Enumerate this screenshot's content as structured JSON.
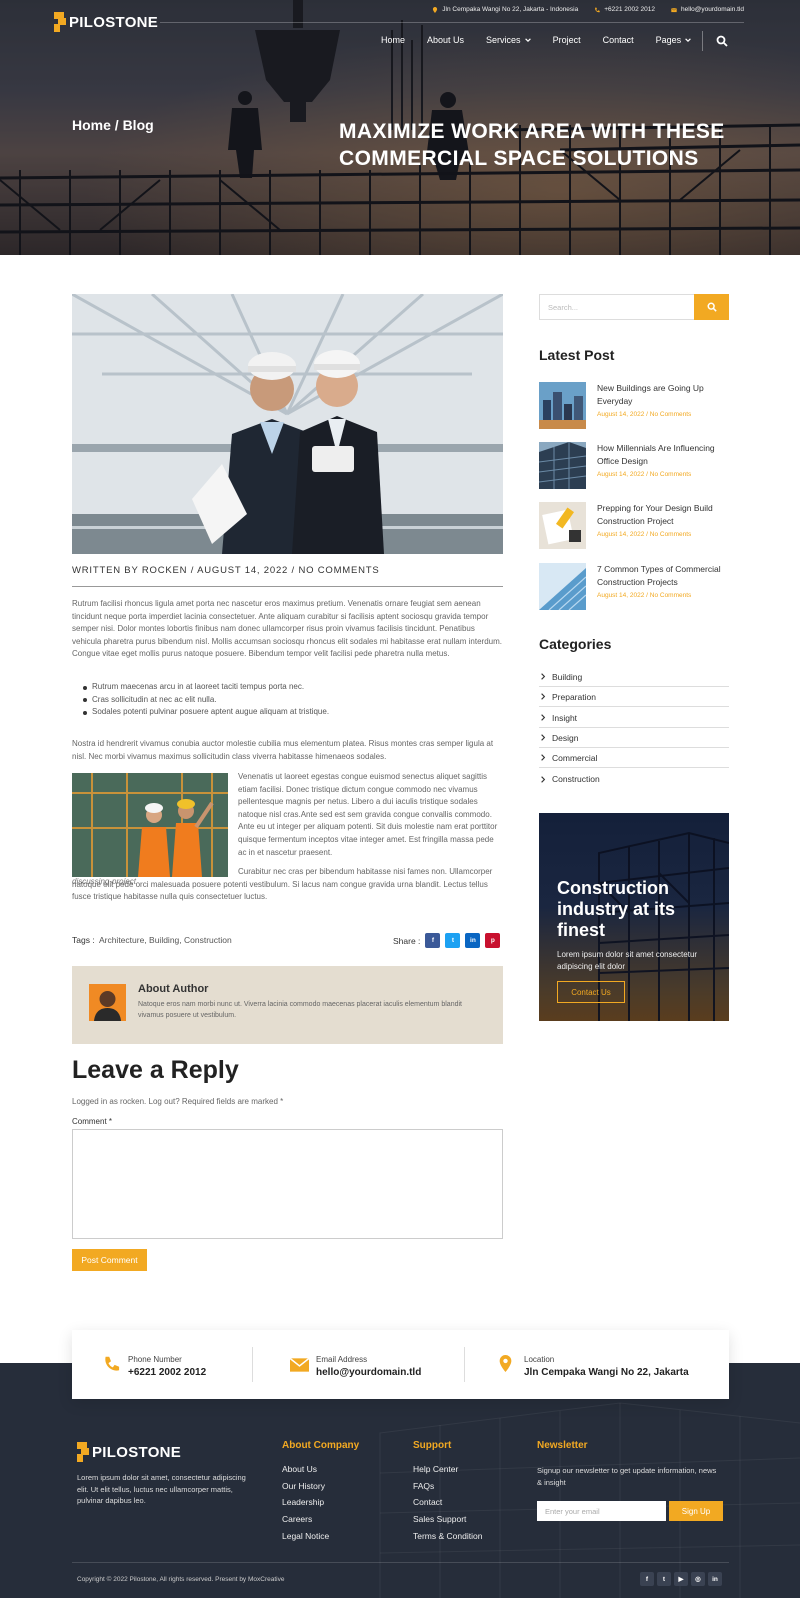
{
  "brand": {
    "name": "PILOSTONE"
  },
  "topbar": {
    "address": "Jln Cempaka Wangi No 22, Jakarta - Indonesia",
    "phone": "+6221 2002 2012",
    "email": "hello@yourdomain.tld"
  },
  "nav": {
    "items": [
      "Home",
      "About Us",
      "Services",
      "Project",
      "Contact",
      "Pages"
    ]
  },
  "hero": {
    "breadcrumb": "Home / Blog",
    "title": "MAXIMIZE WORK AREA WITH THESE COMMERCIAL SPACE SOLUTIONS"
  },
  "post": {
    "meta": "WRITTEN BY ROCKEN / AUGUST 14, 2022 / NO COMMENTS",
    "p1": "Rutrum facilisi rhoncus ligula amet porta nec nascetur eros maximus pretium. Venenatis ornare feugiat sem aenean tincidunt neque porta imperdiet lacinia consectetuer. Ante aliquam curabitur si facilisis aptent sociosqu gravida tempor semper nisi. Dolor montes lobortis finibus nam donec ullamcorper risus proin vivamus facilisis tincidunt. Penatibus vehicula pharetra purus bibendum nisl. Mollis accumsan sociosqu rhoncus elit sodales mi habitasse erat nullam interdum. Congue vitae eget mollis purus natoque posuere. Bibendum tempor velit facilisi pede pharetra nulla metus.",
    "bullets": [
      "Rutrum maecenas arcu in at laoreet taciti tempus porta nec.",
      "Cras sollicitudin at nec ac elit nulla.",
      "Sodales potenti pulvinar posuere aptent augue aliquam at tristique."
    ],
    "p2": "Nostra id hendrerit vivamus conubia auctor molestie cubilia mus elementum platea. Risus montes cras semper ligula at nisl. Nec morbi vivamus maximus sollicitudin class viverra habitasse himenaeos sodales.",
    "p3": "Venenatis ut laoreet egestas congue euismod senectus aliquet sagittis etiam facilisi. Donec tristique dictum congue commodo nec vivamus pellentesque magnis per netus. Libero a dui iaculis tristique sodales natoque nisl cras.Ante sed est sem gravida congue convallis commodo. Ante eu ut integer per aliquam potenti. Sit duis molestie nam erat porttitor quisque fermentum inceptos vitae integer amet. Est fringilla massa pede ac in et nascetur praesent.",
    "p4": "Curabitur nec cras per bibendum habitasse nisi fames non. Ullamcorper natoque elit pede orci malesuada posuere potenti vestibulum. Si lacus nam congue gravida urna blandit. Lectus tellus fusce tristique habitasse nulla quis consectetuer luctus.",
    "caption": "discussing-project",
    "tags_label": "Tags :",
    "tags": "Architecture, Building, Construction",
    "share_label": "Share :"
  },
  "author": {
    "title": "About Author",
    "bio": "Natoque eros nam morbi nunc ut. Viverra lacinia commodo maecenas placerat iaculis elementum blandit vivamus posuere ut vestibulum."
  },
  "reply": {
    "heading": "Leave a Reply",
    "logged": "Logged in as rocken. Log out? Required fields are marked *",
    "comment_label": "Comment *",
    "button": "Post Comment"
  },
  "sidebar": {
    "search_placeholder": "Search...",
    "latest_heading": "Latest Post",
    "latest": [
      {
        "title": "New Buildings are Going Up Everyday",
        "date": "August 14, 2022 / No Comments"
      },
      {
        "title": "How Millennials Are Influencing Office Design",
        "date": "August 14, 2022 / No Comments"
      },
      {
        "title": "Prepping for Your Design Build Construction Project",
        "date": "August 14, 2022 / No Comments"
      },
      {
        "title": "7 Common Types of Commercial Construction Projects",
        "date": "August 14, 2022 / No Comments"
      }
    ],
    "categories_heading": "Categories",
    "categories": [
      "Building",
      "Preparation",
      "Insight",
      "Design",
      "Commercial",
      "Construction"
    ],
    "promo": {
      "title": "Construction industry at its finest",
      "desc": "Lorem ipsum dolor sit amet consectetur adipiscing elit dolor",
      "button": "Contact Us"
    }
  },
  "contact": {
    "phone_label": "Phone Number",
    "phone_value": "+6221 2002 2012",
    "email_label": "Email Address",
    "email_value": "hello@yourdomain.tld",
    "location_label": "Location",
    "location_value": "Jln Cempaka Wangi No 22, Jakarta"
  },
  "footer": {
    "about": "Lorem ipsum dolor sit amet, consectetur adipiscing elit. Ut elit tellus, luctus nec ullamcorper mattis, pulvinar dapibus leo.",
    "company_heading": "About Company",
    "company_links": [
      "About Us",
      "Our History",
      "Leadership",
      "Careers",
      "Legal Notice"
    ],
    "support_heading": "Support",
    "support_links": [
      "Help Center",
      "FAQs",
      "Contact",
      "Sales Support",
      "Terms & Condition"
    ],
    "newsletter_heading": "Newsletter",
    "newsletter_text": "Signup our newsletter to get update information, news & insight",
    "email_placeholder": "Enter your email",
    "signup": "Sign Up",
    "copyright": "Copyright © 2022 Pilostone, All rights reserved. Present by MoxCreative"
  },
  "colors": {
    "accent": "#f2a922",
    "footer_bg": "#262d3a",
    "author_bg": "#e4ddd0"
  }
}
